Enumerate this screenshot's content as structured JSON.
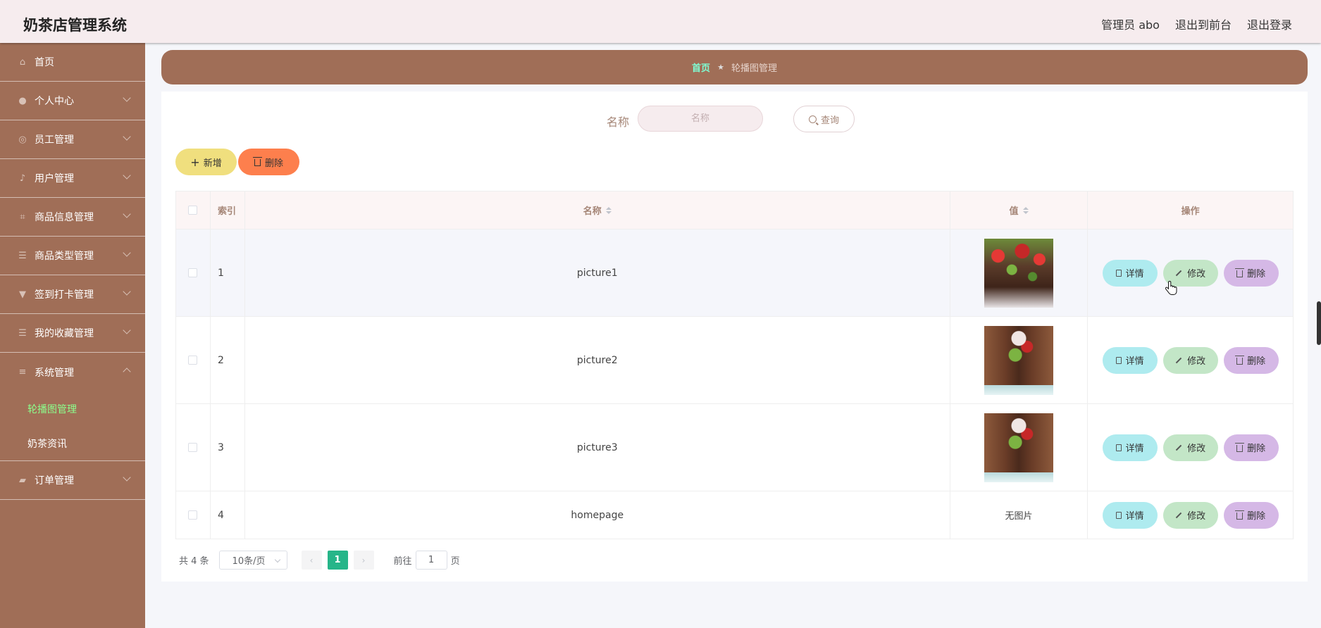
{
  "header": {
    "title": "奶茶店管理系统",
    "admin": "管理员 abo",
    "front": "退出到前台",
    "logout": "退出登录"
  },
  "sidebar": {
    "items": [
      {
        "label": "首页",
        "icon": "home-icon"
      },
      {
        "label": "个人中心",
        "icon": "user-icon"
      },
      {
        "label": "员工管理",
        "icon": "globe-icon"
      },
      {
        "label": "用户管理",
        "icon": "mic-icon"
      },
      {
        "label": "商品信息管理",
        "icon": "crop-icon"
      },
      {
        "label": "商品类型管理",
        "icon": "list-icon"
      },
      {
        "label": "签到打卡管理",
        "icon": "medal-icon"
      },
      {
        "label": "我的收藏管理",
        "icon": "list-icon"
      },
      {
        "label": "系统管理",
        "icon": "sliders-icon"
      },
      {
        "label": "订单管理",
        "icon": "shop-icon"
      }
    ],
    "sub": [
      "轮播图管理",
      "奶茶资讯"
    ]
  },
  "breadcrumb": {
    "home": "首页",
    "current": "轮播图管理"
  },
  "search": {
    "label": "名称",
    "placeholder": "名称",
    "button": "查询"
  },
  "actions": {
    "add": "新增",
    "delete": "删除"
  },
  "table": {
    "headers": {
      "index": "索引",
      "name": "名称",
      "value": "值",
      "ops": "操作"
    },
    "rows": [
      {
        "index": "1",
        "name": "picture1",
        "value": "image"
      },
      {
        "index": "2",
        "name": "picture2",
        "value": "image"
      },
      {
        "index": "3",
        "name": "picture3",
        "value": "image"
      },
      {
        "index": "4",
        "name": "homepage",
        "value": "无图片"
      }
    ],
    "ops": {
      "detail": "详情",
      "edit": "修改",
      "delete": "删除"
    }
  },
  "pager": {
    "total": "共 4 条",
    "size": "10条/页",
    "page": "1",
    "goto": "前往",
    "goto_value": "1",
    "page_unit": "页"
  },
  "colors": {
    "brand": "#a06e57",
    "header_bg": "#f6ecee",
    "active_page": "#26b589"
  }
}
